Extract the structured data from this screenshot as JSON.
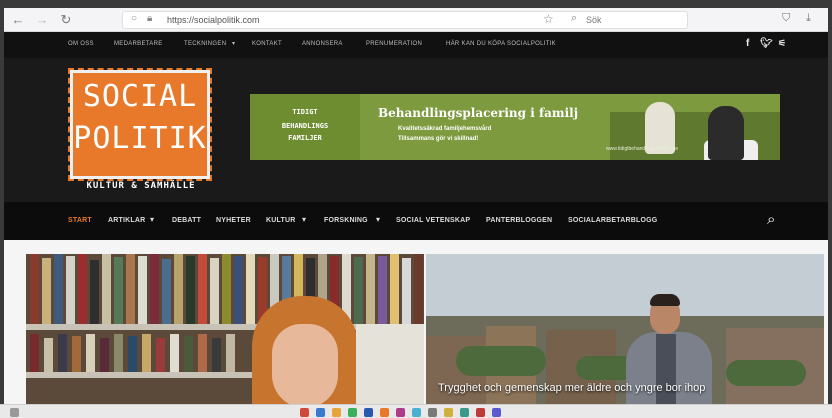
{
  "browser": {
    "url": "https://socialpolitik.com",
    "search_placeholder": "Sök"
  },
  "topnav": {
    "items": [
      "OM OSS",
      "MEDARBETARE",
      "TECKNINGEN",
      "KONTAKT",
      "ANNONSERA",
      "PRENUMERATION",
      "HÄR KAN DU KÖPA SOCIALPOLITIK"
    ],
    "social": [
      "f",
      "t",
      "rss"
    ]
  },
  "logo": {
    "line1": "SOCIAL",
    "line2": "POLITIK",
    "tagline": "KULTUR & SAMHÄLLE"
  },
  "banner": {
    "left_lines": [
      "TIDIGT",
      "BEHANDLINGS",
      "FAMILJER"
    ],
    "title": "Behandlingsplacering i familj",
    "sub1": "Kvalitetssäkrad familjehemsvård",
    "sub2": "Tillsammans gör vi skillnad!",
    "link": "www.tidigtbehandlingsfamiljer.se"
  },
  "mainnav": {
    "items": [
      "START",
      "ARTIKLAR",
      "DEBATT",
      "NYHETER",
      "KULTUR",
      "FORSKNING",
      "SOCIAL VETENSKAP",
      "PANTERBLOGGEN",
      "SOCIALARBETARBLOGG"
    ],
    "active": "START"
  },
  "features": {
    "caption2": "Trygghet och gemenskap mer äldre och yngre bor ihop"
  },
  "colors": {
    "accent": "#e8792a",
    "nav_bg": "#0c0c0c",
    "banner_green": "#7d9a3e"
  }
}
